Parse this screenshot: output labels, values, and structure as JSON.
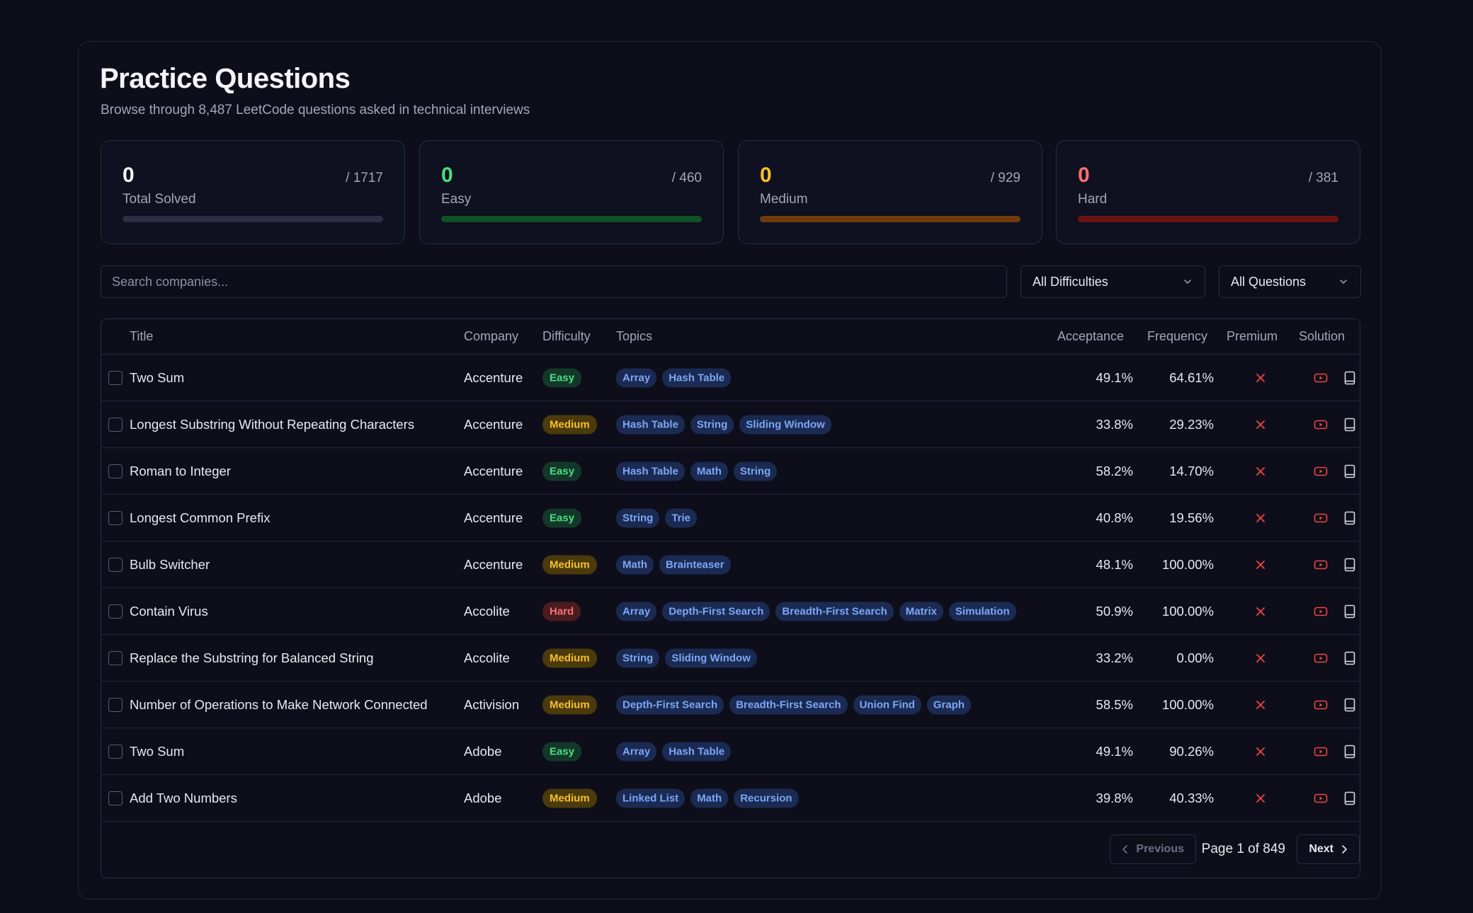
{
  "header": {
    "title": "Practice Questions",
    "subtitle": "Browse through 8,487 LeetCode questions asked in technical interviews"
  },
  "stats": [
    {
      "value": "0",
      "total": "/ 1717",
      "label": "Total Solved",
      "color": "#f4f5fa",
      "bar_color": "#2b2e44"
    },
    {
      "value": "0",
      "total": "/ 460",
      "label": "Easy",
      "color": "#4ade80",
      "bar_color": "#0f5225"
    },
    {
      "value": "0",
      "total": "/ 929",
      "label": "Medium",
      "color": "#f6c02a",
      "bar_color": "#6e3b0c"
    },
    {
      "value": "0",
      "total": "/ 381",
      "label": "Hard",
      "color": "#f87171",
      "bar_color": "#6b1414"
    }
  ],
  "filters": {
    "search_placeholder": "Search companies...",
    "difficulty_selected": "All Difficulties",
    "questions_selected": "All Questions"
  },
  "table": {
    "columns": {
      "title": "Title",
      "company": "Company",
      "difficulty": "Difficulty",
      "topics": "Topics",
      "acceptance": "Acceptance",
      "frequency": "Frequency",
      "premium": "Premium",
      "solution": "Solution"
    },
    "rows": [
      {
        "title": "Two Sum",
        "company": "Accenture",
        "difficulty": "Easy",
        "topics": [
          "Array",
          "Hash Table"
        ],
        "acceptance": "49.1%",
        "frequency": "64.61%"
      },
      {
        "title": "Longest Substring Without Repeating Characters",
        "company": "Accenture",
        "difficulty": "Medium",
        "topics": [
          "Hash Table",
          "String",
          "Sliding Window"
        ],
        "acceptance": "33.8%",
        "frequency": "29.23%"
      },
      {
        "title": "Roman to Integer",
        "company": "Accenture",
        "difficulty": "Easy",
        "topics": [
          "Hash Table",
          "Math",
          "String"
        ],
        "acceptance": "58.2%",
        "frequency": "14.70%"
      },
      {
        "title": "Longest Common Prefix",
        "company": "Accenture",
        "difficulty": "Easy",
        "topics": [
          "String",
          "Trie"
        ],
        "acceptance": "40.8%",
        "frequency": "19.56%"
      },
      {
        "title": "Bulb Switcher",
        "company": "Accenture",
        "difficulty": "Medium",
        "topics": [
          "Math",
          "Brainteaser"
        ],
        "acceptance": "48.1%",
        "frequency": "100.00%"
      },
      {
        "title": "Contain Virus",
        "company": "Accolite",
        "difficulty": "Hard",
        "topics": [
          "Array",
          "Depth-First Search",
          "Breadth-First Search",
          "Matrix",
          "Simulation"
        ],
        "acceptance": "50.9%",
        "frequency": "100.00%"
      },
      {
        "title": "Replace the Substring for Balanced String",
        "company": "Accolite",
        "difficulty": "Medium",
        "topics": [
          "String",
          "Sliding Window"
        ],
        "acceptance": "33.2%",
        "frequency": "0.00%"
      },
      {
        "title": "Number of Operations to Make Network Connected",
        "company": "Activision",
        "difficulty": "Medium",
        "topics": [
          "Depth-First Search",
          "Breadth-First Search",
          "Union Find",
          "Graph"
        ],
        "acceptance": "58.5%",
        "frequency": "100.00%"
      },
      {
        "title": "Two Sum",
        "company": "Adobe",
        "difficulty": "Easy",
        "topics": [
          "Array",
          "Hash Table"
        ],
        "acceptance": "49.1%",
        "frequency": "90.26%"
      },
      {
        "title": "Add Two Numbers",
        "company": "Adobe",
        "difficulty": "Medium",
        "topics": [
          "Linked List",
          "Math",
          "Recursion"
        ],
        "acceptance": "39.8%",
        "frequency": "40.33%"
      }
    ]
  },
  "pagination": {
    "previous_label": "Previous",
    "page_info": "Page 1 of 849",
    "next_label": "Next"
  },
  "icons": {
    "premium": "x-icon",
    "video": "youtube-icon",
    "solution": "book-icon"
  }
}
